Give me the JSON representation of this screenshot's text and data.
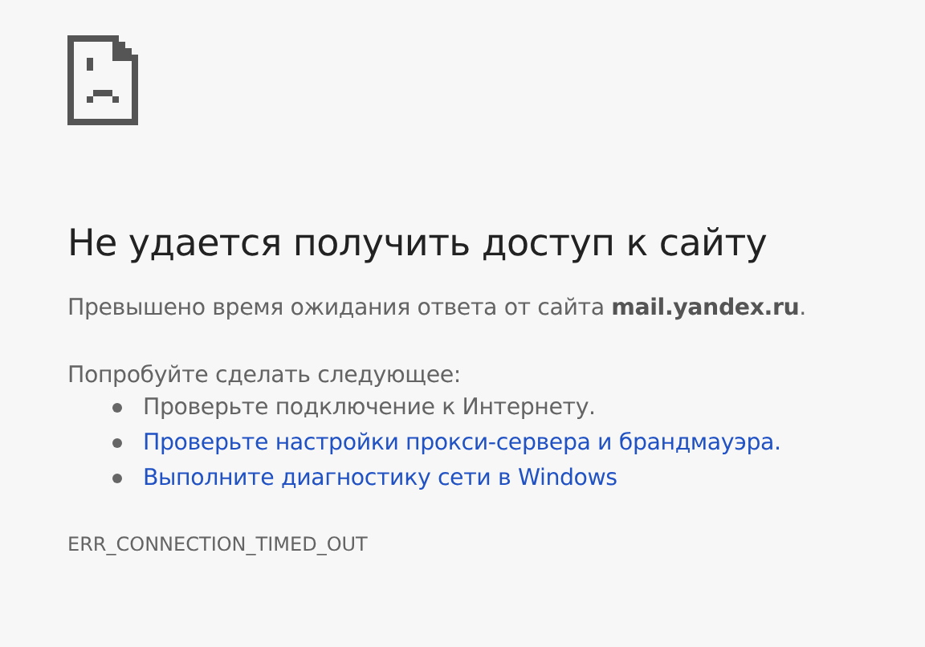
{
  "heading": "Не удается получить доступ к сайту",
  "summary": "Превышено время ожидания ответа от сайта **mail.yandex.ru**.",
  "suggestions_title": "Попробуйте сделать следующее:",
  "suggestions": [
    {
      "kind": "text",
      "label": "Проверьте подключение к Интернету."
    },
    {
      "kind": "link",
      "label": "Проверьте настройки прокси-сервера и брандмауэра."
    },
    {
      "kind": "link",
      "label": "Выполните диагностику сети в Windows"
    }
  ],
  "error_code": "ERR_CONNECTION_TIMED_OUT"
}
